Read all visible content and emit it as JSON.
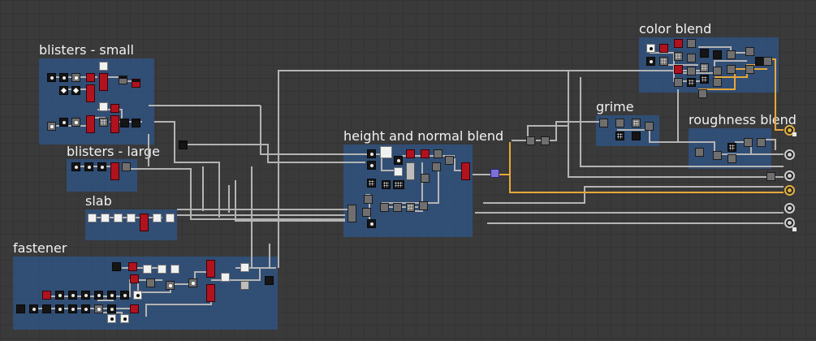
{
  "app": {
    "view": "graph-canvas"
  },
  "frames": [
    {
      "id": "blisters-small",
      "title": "blisters - small"
    },
    {
      "id": "blisters-large",
      "title": "blisters - large"
    },
    {
      "id": "slab",
      "title": "slab"
    },
    {
      "id": "fastener",
      "title": "fastener"
    },
    {
      "id": "height-normal",
      "title": "height and normal blend"
    },
    {
      "id": "color-blend",
      "title": "color blend"
    },
    {
      "id": "grime",
      "title": "grime"
    },
    {
      "id": "roughness-blend",
      "title": "roughness blend"
    }
  ],
  "colors": {
    "canvas_bg": "#3a3a3a",
    "frame_bg": "#2e568c",
    "wire_gray": "#b4b4b4",
    "wire_orange": "#e8a83a",
    "node_red": "#b0121e",
    "node_purple": "#7a72d8"
  },
  "outputs": [
    {
      "icon": "material-output-basecolor-icon"
    },
    {
      "icon": "material-output-roughness-icon"
    },
    {
      "icon": "material-output-metallic-icon"
    },
    {
      "icon": "material-output-normal-icon"
    },
    {
      "icon": "material-output-height-icon"
    },
    {
      "icon": "material-output-ao-icon"
    }
  ]
}
